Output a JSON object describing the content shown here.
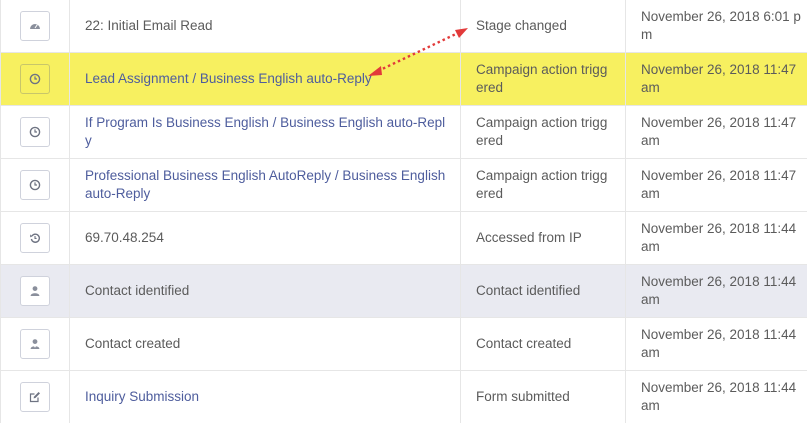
{
  "rows": [
    {
      "event": "22: Initial Email Read",
      "type": "Stage changed",
      "date": "November 26, 2018 6:01 pm",
      "icon": "dashboard-icon"
    },
    {
      "event": "Lead Assignment / Business English auto-Reply",
      "type": "Campaign action triggered",
      "date": "November 26, 2018 11:47 am",
      "icon": "clock-icon"
    },
    {
      "event": "If Program Is Business English / Business English auto-Reply",
      "type": "Campaign action triggered",
      "date": "November 26, 2018 11:47 am",
      "icon": "clock-icon"
    },
    {
      "event": "Professional Business English AutoReply / Business English auto-Reply",
      "type": "Campaign action triggered",
      "date": "November 26, 2018 11:47 am",
      "icon": "clock-icon"
    },
    {
      "event": "69.70.48.254",
      "type": "Accessed from IP",
      "date": "November 26, 2018 11:44 am",
      "icon": "history-icon"
    },
    {
      "event": "Contact identified",
      "type": "Contact identified",
      "date": "November 26, 2018 11:44 am",
      "icon": "user-icon"
    },
    {
      "event": "Contact created",
      "type": "Contact created",
      "date": "November 26, 2018 11:44 am",
      "icon": "user-plus-icon"
    },
    {
      "event": "Inquiry Submission",
      "type": "Form submitted",
      "date": "November 26, 2018 11:44 am",
      "icon": "edit-icon"
    }
  ],
  "colors": {
    "highlight": "#f7f060",
    "link": "#4e5d9d",
    "annotation_arrow": "#e23a3a"
  }
}
